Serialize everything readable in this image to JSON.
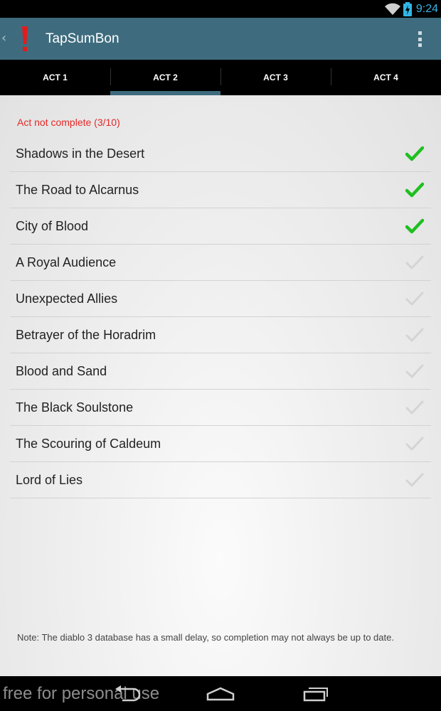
{
  "status_bar": {
    "time": "9:24",
    "icons": [
      "wifi-icon",
      "battery-charging-icon"
    ]
  },
  "action_bar": {
    "title": "TapSumBon",
    "app_icon": "exclamation-icon",
    "menu_icon": "overflow-menu-icon"
  },
  "tabs": [
    {
      "label": "ACT 1",
      "selected": false
    },
    {
      "label": "ACT 2",
      "selected": true
    },
    {
      "label": "ACT 3",
      "selected": false
    },
    {
      "label": "ACT 4",
      "selected": false
    }
  ],
  "act_status": "Act not complete (3/10)",
  "quests": [
    {
      "title": "Shadows in the Desert",
      "complete": true
    },
    {
      "title": "The Road to Alcarnus",
      "complete": true
    },
    {
      "title": "City of Blood",
      "complete": true
    },
    {
      "title": "A Royal Audience",
      "complete": false
    },
    {
      "title": "Unexpected Allies",
      "complete": false
    },
    {
      "title": "Betrayer of the Horadrim",
      "complete": false
    },
    {
      "title": "Blood and Sand",
      "complete": false
    },
    {
      "title": "The Black Soulstone",
      "complete": false
    },
    {
      "title": "The Scouring of Caldeum",
      "complete": false
    },
    {
      "title": "Lord of Lies",
      "complete": false
    }
  ],
  "note": "Note: The diablo 3 database has a small delay, so completion may not always be up to date.",
  "nav_bar": {
    "watermark": "free for personal use",
    "buttons": [
      "back-icon",
      "home-icon",
      "recents-icon"
    ]
  },
  "colors": {
    "action_bar": "#3e6c7e",
    "complete_check": "#1fbf1f",
    "incomplete_check": "#d4d4d4",
    "status_text": "#e62727",
    "clock": "#33b5e5"
  }
}
